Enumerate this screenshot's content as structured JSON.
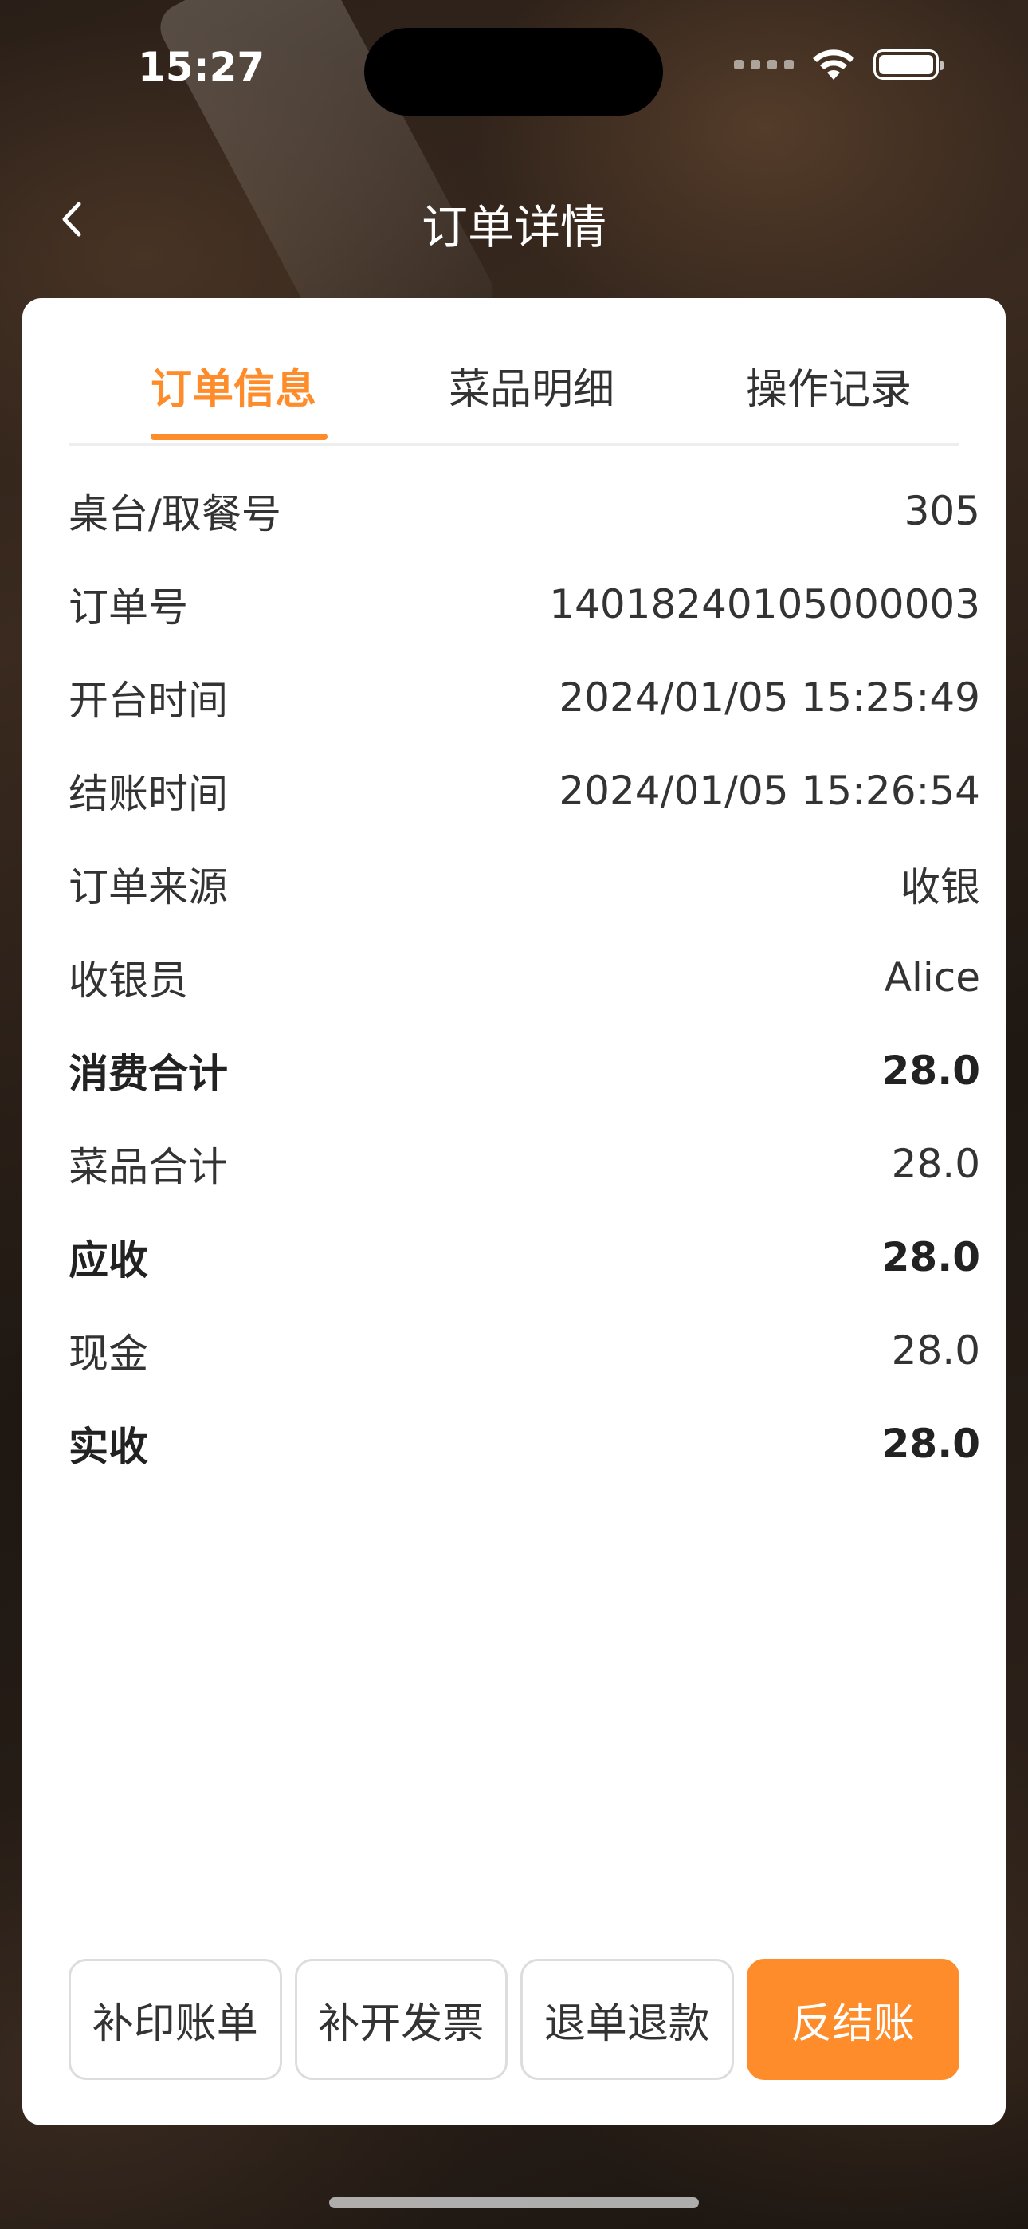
{
  "status_bar": {
    "time": "15:27"
  },
  "nav": {
    "title": "订单详情",
    "back_icon": "chevron-left-icon"
  },
  "tabs": [
    {
      "label": "订单信息",
      "active": true
    },
    {
      "label": "菜品明细",
      "active": false
    },
    {
      "label": "操作记录",
      "active": false
    }
  ],
  "order": {
    "rows": [
      {
        "label": "桌台/取餐号",
        "value": "305",
        "bold": false
      },
      {
        "label": "订单号",
        "value": "14018240105000003",
        "bold": false
      },
      {
        "label": "开台时间",
        "value": "2024/01/05 15:25:49",
        "bold": false
      },
      {
        "label": "结账时间",
        "value": "2024/01/05 15:26:54",
        "bold": false
      },
      {
        "label": "订单来源",
        "value": "收银",
        "bold": false
      },
      {
        "label": "收银员",
        "value": "Alice",
        "bold": false
      },
      {
        "label": "消费合计",
        "value": "28.0",
        "bold": true
      },
      {
        "label": "菜品合计",
        "value": "28.0",
        "bold": false
      },
      {
        "label": "应收",
        "value": "28.0",
        "bold": true
      },
      {
        "label": "现金",
        "value": "28.0",
        "bold": false
      },
      {
        "label": "实收",
        "value": "28.0",
        "bold": true
      }
    ]
  },
  "actions": {
    "reprint_bill": "补印账单",
    "reissue_invoice": "补开发票",
    "refund": "退单退款",
    "reverse_checkout": "反结账"
  },
  "colors": {
    "accent": "#ff8c2a",
    "text": "#333333",
    "card": "#ffffff"
  }
}
